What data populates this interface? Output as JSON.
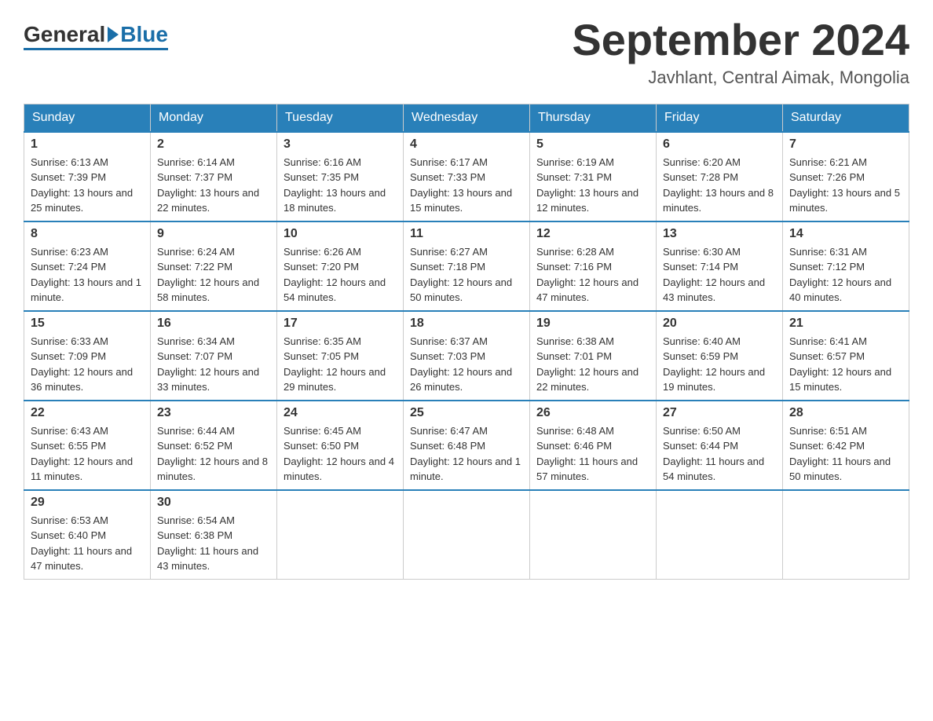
{
  "logo": {
    "general": "General",
    "blue": "Blue"
  },
  "header": {
    "month_year": "September 2024",
    "location": "Javhlant, Central Aimak, Mongolia"
  },
  "days_of_week": [
    "Sunday",
    "Monday",
    "Tuesday",
    "Wednesday",
    "Thursday",
    "Friday",
    "Saturday"
  ],
  "weeks": [
    [
      {
        "day": "1",
        "sunrise": "6:13 AM",
        "sunset": "7:39 PM",
        "daylight": "13 hours and 25 minutes."
      },
      {
        "day": "2",
        "sunrise": "6:14 AM",
        "sunset": "7:37 PM",
        "daylight": "13 hours and 22 minutes."
      },
      {
        "day": "3",
        "sunrise": "6:16 AM",
        "sunset": "7:35 PM",
        "daylight": "13 hours and 18 minutes."
      },
      {
        "day": "4",
        "sunrise": "6:17 AM",
        "sunset": "7:33 PM",
        "daylight": "13 hours and 15 minutes."
      },
      {
        "day": "5",
        "sunrise": "6:19 AM",
        "sunset": "7:31 PM",
        "daylight": "13 hours and 12 minutes."
      },
      {
        "day": "6",
        "sunrise": "6:20 AM",
        "sunset": "7:28 PM",
        "daylight": "13 hours and 8 minutes."
      },
      {
        "day": "7",
        "sunrise": "6:21 AM",
        "sunset": "7:26 PM",
        "daylight": "13 hours and 5 minutes."
      }
    ],
    [
      {
        "day": "8",
        "sunrise": "6:23 AM",
        "sunset": "7:24 PM",
        "daylight": "13 hours and 1 minute."
      },
      {
        "day": "9",
        "sunrise": "6:24 AM",
        "sunset": "7:22 PM",
        "daylight": "12 hours and 58 minutes."
      },
      {
        "day": "10",
        "sunrise": "6:26 AM",
        "sunset": "7:20 PM",
        "daylight": "12 hours and 54 minutes."
      },
      {
        "day": "11",
        "sunrise": "6:27 AM",
        "sunset": "7:18 PM",
        "daylight": "12 hours and 50 minutes."
      },
      {
        "day": "12",
        "sunrise": "6:28 AM",
        "sunset": "7:16 PM",
        "daylight": "12 hours and 47 minutes."
      },
      {
        "day": "13",
        "sunrise": "6:30 AM",
        "sunset": "7:14 PM",
        "daylight": "12 hours and 43 minutes."
      },
      {
        "day": "14",
        "sunrise": "6:31 AM",
        "sunset": "7:12 PM",
        "daylight": "12 hours and 40 minutes."
      }
    ],
    [
      {
        "day": "15",
        "sunrise": "6:33 AM",
        "sunset": "7:09 PM",
        "daylight": "12 hours and 36 minutes."
      },
      {
        "day": "16",
        "sunrise": "6:34 AM",
        "sunset": "7:07 PM",
        "daylight": "12 hours and 33 minutes."
      },
      {
        "day": "17",
        "sunrise": "6:35 AM",
        "sunset": "7:05 PM",
        "daylight": "12 hours and 29 minutes."
      },
      {
        "day": "18",
        "sunrise": "6:37 AM",
        "sunset": "7:03 PM",
        "daylight": "12 hours and 26 minutes."
      },
      {
        "day": "19",
        "sunrise": "6:38 AM",
        "sunset": "7:01 PM",
        "daylight": "12 hours and 22 minutes."
      },
      {
        "day": "20",
        "sunrise": "6:40 AM",
        "sunset": "6:59 PM",
        "daylight": "12 hours and 19 minutes."
      },
      {
        "day": "21",
        "sunrise": "6:41 AM",
        "sunset": "6:57 PM",
        "daylight": "12 hours and 15 minutes."
      }
    ],
    [
      {
        "day": "22",
        "sunrise": "6:43 AM",
        "sunset": "6:55 PM",
        "daylight": "12 hours and 11 minutes."
      },
      {
        "day": "23",
        "sunrise": "6:44 AM",
        "sunset": "6:52 PM",
        "daylight": "12 hours and 8 minutes."
      },
      {
        "day": "24",
        "sunrise": "6:45 AM",
        "sunset": "6:50 PM",
        "daylight": "12 hours and 4 minutes."
      },
      {
        "day": "25",
        "sunrise": "6:47 AM",
        "sunset": "6:48 PM",
        "daylight": "12 hours and 1 minute."
      },
      {
        "day": "26",
        "sunrise": "6:48 AM",
        "sunset": "6:46 PM",
        "daylight": "11 hours and 57 minutes."
      },
      {
        "day": "27",
        "sunrise": "6:50 AM",
        "sunset": "6:44 PM",
        "daylight": "11 hours and 54 minutes."
      },
      {
        "day": "28",
        "sunrise": "6:51 AM",
        "sunset": "6:42 PM",
        "daylight": "11 hours and 50 minutes."
      }
    ],
    [
      {
        "day": "29",
        "sunrise": "6:53 AM",
        "sunset": "6:40 PM",
        "daylight": "11 hours and 47 minutes."
      },
      {
        "day": "30",
        "sunrise": "6:54 AM",
        "sunset": "6:38 PM",
        "daylight": "11 hours and 43 minutes."
      },
      null,
      null,
      null,
      null,
      null
    ]
  ],
  "labels": {
    "sunrise": "Sunrise:",
    "sunset": "Sunset:",
    "daylight": "Daylight:"
  }
}
